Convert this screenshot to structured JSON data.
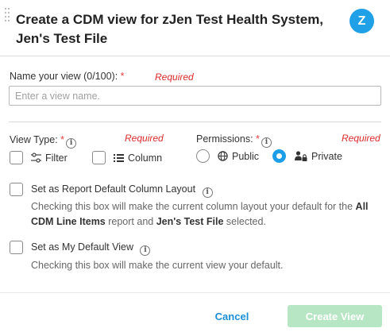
{
  "dialog": {
    "title": "Create a CDM view for zJen Test Health System, Jen's Test File",
    "avatar_letter": "Z"
  },
  "name_field": {
    "label": "Name your view (0/100):",
    "required_mark": "*",
    "required_text": "Required",
    "placeholder": "Enter a view name.",
    "value": ""
  },
  "view_type": {
    "label": "View Type:",
    "required_mark": "*",
    "info_glyph": "i",
    "required_text": "Required",
    "options": [
      {
        "label": "Filter",
        "icon": "filter-sliders-icon",
        "checked": false
      },
      {
        "label": "Column",
        "icon": "list-icon",
        "checked": false
      }
    ]
  },
  "permissions": {
    "label": "Permissions:",
    "required_mark": "*",
    "info_glyph": "i",
    "required_text": "Required",
    "options": [
      {
        "label": "Public",
        "icon": "globe-icon",
        "selected": false
      },
      {
        "label": "Private",
        "icon": "users-lock-icon",
        "selected": true
      }
    ]
  },
  "report_default": {
    "label": "Set as Report Default Column Layout",
    "info_glyph": "i",
    "checked": false,
    "desc_prefix": "Checking this box will make the current column layout your default for the ",
    "desc_bold1": "All CDM Line Items",
    "desc_mid": " report and ",
    "desc_bold2": "Jen's Test File",
    "desc_suffix": " selected."
  },
  "my_default": {
    "label": "Set as My Default View",
    "info_glyph": "i",
    "checked": false,
    "desc": "Checking this box will make the current view your default."
  },
  "footer": {
    "cancel_label": "Cancel",
    "create_label": "Create View"
  },
  "colors": {
    "accent": "#1d9ee8",
    "avatar": "#20a0e6",
    "required": "#d92b2b",
    "create_disabled": "#b7e6c4",
    "cancel": "#1d8fd6"
  }
}
